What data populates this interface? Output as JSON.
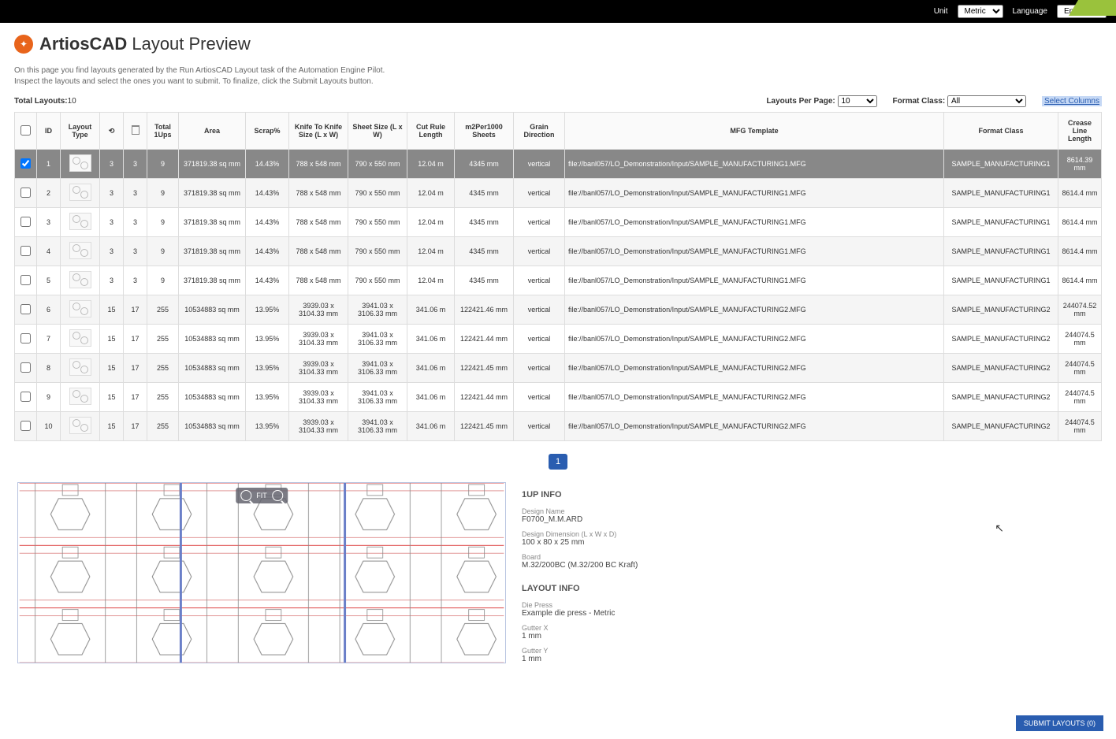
{
  "topbar": {
    "unit_label": "Unit",
    "unit_value": "Metric",
    "lang_label": "Language",
    "lang_value": "English"
  },
  "title_bold": "ArtiosCAD",
  "title_rest": " Layout Preview",
  "description_l1": "On this page you find layouts generated by the Run ArtiosCAD Layout task of the Automation Engine Pilot.",
  "description_l2": "Inspect the layouts and select the ones you want to submit. To finalize, click the Submit Layouts button.",
  "total_layouts_label": "Total Layouts:",
  "total_layouts_value": "10",
  "layouts_per_page_label": "Layouts Per Page:",
  "layouts_per_page_value": "10",
  "format_class_label": "Format Class:",
  "format_class_value": "All",
  "select_columns": "Select Columns",
  "columns": [
    "",
    "ID",
    "Layout Type",
    "⟲",
    "🗑",
    "Total 1Ups",
    "Area",
    "Scrap%",
    "Knife To Knife Size (L x W)",
    "Sheet Size (L x W)",
    "Cut Rule Length",
    "m2Per1000 Sheets",
    "Grain Direction",
    "MFG Template",
    "Format Class",
    "Crease Line Length"
  ],
  "rows": [
    {
      "sel": true,
      "id": "1",
      "c3": "3",
      "c4": "3",
      "ups": "9",
      "area": "371819.38 sq mm",
      "scrap": "14.43%",
      "k2k": "788 x 548 mm",
      "sheet": "790 x 550 mm",
      "cut": "12.04 m",
      "m2": "4345 mm",
      "grain": "vertical",
      "mfg": "file://banl057/LO_Demonstration/Input/SAMPLE_MANUFACTURING1.MFG",
      "fc": "SAMPLE_MANUFACTURING1",
      "crease": "8614.39 mm"
    },
    {
      "sel": false,
      "id": "2",
      "c3": "3",
      "c4": "3",
      "ups": "9",
      "area": "371819.38 sq mm",
      "scrap": "14.43%",
      "k2k": "788 x 548 mm",
      "sheet": "790 x 550 mm",
      "cut": "12.04 m",
      "m2": "4345 mm",
      "grain": "vertical",
      "mfg": "file://banl057/LO_Demonstration/Input/SAMPLE_MANUFACTURING1.MFG",
      "fc": "SAMPLE_MANUFACTURING1",
      "crease": "8614.4 mm"
    },
    {
      "sel": false,
      "id": "3",
      "c3": "3",
      "c4": "3",
      "ups": "9",
      "area": "371819.38 sq mm",
      "scrap": "14.43%",
      "k2k": "788 x 548 mm",
      "sheet": "790 x 550 mm",
      "cut": "12.04 m",
      "m2": "4345 mm",
      "grain": "vertical",
      "mfg": "file://banl057/LO_Demonstration/Input/SAMPLE_MANUFACTURING1.MFG",
      "fc": "SAMPLE_MANUFACTURING1",
      "crease": "8614.4 mm"
    },
    {
      "sel": false,
      "id": "4",
      "c3": "3",
      "c4": "3",
      "ups": "9",
      "area": "371819.38 sq mm",
      "scrap": "14.43%",
      "k2k": "788 x 548 mm",
      "sheet": "790 x 550 mm",
      "cut": "12.04 m",
      "m2": "4345 mm",
      "grain": "vertical",
      "mfg": "file://banl057/LO_Demonstration/Input/SAMPLE_MANUFACTURING1.MFG",
      "fc": "SAMPLE_MANUFACTURING1",
      "crease": "8614.4 mm"
    },
    {
      "sel": false,
      "id": "5",
      "c3": "3",
      "c4": "3",
      "ups": "9",
      "area": "371819.38 sq mm",
      "scrap": "14.43%",
      "k2k": "788 x 548 mm",
      "sheet": "790 x 550 mm",
      "cut": "12.04 m",
      "m2": "4345 mm",
      "grain": "vertical",
      "mfg": "file://banl057/LO_Demonstration/Input/SAMPLE_MANUFACTURING1.MFG",
      "fc": "SAMPLE_MANUFACTURING1",
      "crease": "8614.4 mm"
    },
    {
      "sel": false,
      "id": "6",
      "c3": "15",
      "c4": "17",
      "ups": "255",
      "area": "10534883 sq mm",
      "scrap": "13.95%",
      "k2k": "3939.03 x 3104.33 mm",
      "sheet": "3941.03 x 3106.33 mm",
      "cut": "341.06 m",
      "m2": "122421.46 mm",
      "grain": "vertical",
      "mfg": "file://banl057/LO_Demonstration/Input/SAMPLE_MANUFACTURING2.MFG",
      "fc": "SAMPLE_MANUFACTURING2",
      "crease": "244074.52 mm"
    },
    {
      "sel": false,
      "id": "7",
      "c3": "15",
      "c4": "17",
      "ups": "255",
      "area": "10534883 sq mm",
      "scrap": "13.95%",
      "k2k": "3939.03 x 3104.33 mm",
      "sheet": "3941.03 x 3106.33 mm",
      "cut": "341.06 m",
      "m2": "122421.44 mm",
      "grain": "vertical",
      "mfg": "file://banl057/LO_Demonstration/Input/SAMPLE_MANUFACTURING2.MFG",
      "fc": "SAMPLE_MANUFACTURING2",
      "crease": "244074.5 mm"
    },
    {
      "sel": false,
      "id": "8",
      "c3": "15",
      "c4": "17",
      "ups": "255",
      "area": "10534883 sq mm",
      "scrap": "13.95%",
      "k2k": "3939.03 x 3104.33 mm",
      "sheet": "3941.03 x 3106.33 mm",
      "cut": "341.06 m",
      "m2": "122421.45 mm",
      "grain": "vertical",
      "mfg": "file://banl057/LO_Demonstration/Input/SAMPLE_MANUFACTURING2.MFG",
      "fc": "SAMPLE_MANUFACTURING2",
      "crease": "244074.5 mm"
    },
    {
      "sel": false,
      "id": "9",
      "c3": "15",
      "c4": "17",
      "ups": "255",
      "area": "10534883 sq mm",
      "scrap": "13.95%",
      "k2k": "3939.03 x 3104.33 mm",
      "sheet": "3941.03 x 3106.33 mm",
      "cut": "341.06 m",
      "m2": "122421.44 mm",
      "grain": "vertical",
      "mfg": "file://banl057/LO_Demonstration/Input/SAMPLE_MANUFACTURING2.MFG",
      "fc": "SAMPLE_MANUFACTURING2",
      "crease": "244074.5 mm"
    },
    {
      "sel": false,
      "id": "10",
      "c3": "15",
      "c4": "17",
      "ups": "255",
      "area": "10534883 sq mm",
      "scrap": "13.95%",
      "k2k": "3939.03 x 3104.33 mm",
      "sheet": "3941.03 x 3106.33 mm",
      "cut": "341.06 m",
      "m2": "122421.45 mm",
      "grain": "vertical",
      "mfg": "file://banl057/LO_Demonstration/Input/SAMPLE_MANUFACTURING2.MFG",
      "fc": "SAMPLE_MANUFACTURING2",
      "crease": "244074.5 mm"
    }
  ],
  "page_number": "1",
  "fit_label": "FIT",
  "info": {
    "oneup_header": "1UP INFO",
    "design_name_label": "Design Name",
    "design_name_value": "F0700_M.M.ARD",
    "design_dim_label": "Design Dimension (L x W x D)",
    "design_dim_value": "100 x 80 x 25 mm",
    "board_label": "Board",
    "board_value": "M.32/200BC (M.32/200 BC Kraft)",
    "layout_header": "LAYOUT INFO",
    "die_press_label": "Die Press",
    "die_press_value": "Example die press - Metric",
    "gutter_x_label": "Gutter X",
    "gutter_x_value": "1 mm",
    "gutter_y_label": "Gutter Y",
    "gutter_y_value": "1 mm"
  },
  "submit_button": "SUBMIT LAYOUTS (0)"
}
